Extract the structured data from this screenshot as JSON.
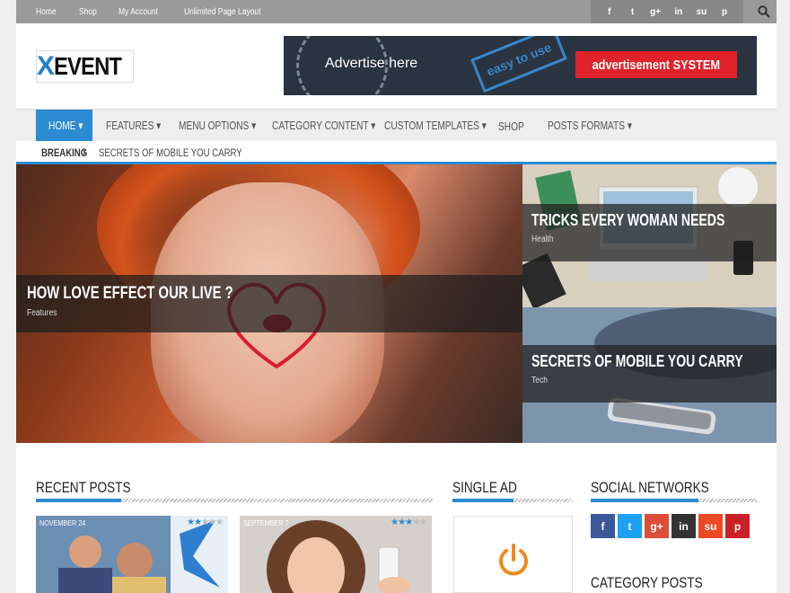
{
  "topbar": {
    "links": [
      "Home",
      "Shop",
      "My Account",
      "Unlimited Page Layout"
    ],
    "social_icons": [
      "f",
      "t",
      "g+",
      "in",
      "su",
      "p"
    ]
  },
  "header": {
    "logo_x": "X",
    "logo_rest": "EVENT",
    "ad": {
      "text": "Advertise here",
      "stamp": "easy to use",
      "button": "advertisement SYSTEM"
    }
  },
  "nav": {
    "items": [
      {
        "label": "HOME ▾"
      },
      {
        "label": "FEATURES ▾"
      },
      {
        "label": "MENU OPTIONS ▾"
      },
      {
        "label": "CATEGORY CONTENT ▾"
      },
      {
        "label": "CUSTOM TEMPLATES ▾"
      },
      {
        "label": "SHOP"
      },
      {
        "label": "POSTS FORMATS ▾"
      }
    ]
  },
  "breaking": {
    "label": "BREAKING",
    "ticker": "SECRETS OF MOBILE YOU CARRY"
  },
  "slider": {
    "main": {
      "title": "HOW LOVE EFFECT OUR LIVE ?",
      "category": "Features"
    },
    "side": [
      {
        "title": "TRICKS EVERY WOMAN NEEDS",
        "category": "Health"
      },
      {
        "title": "SECRETS OF MOBILE YOU CARRY",
        "category": "Tech"
      }
    ]
  },
  "widgets": {
    "recent_posts": "RECENT POSTS",
    "single_ad": "SINGLE AD",
    "social_networks": "SOCIAL NETWORKS",
    "category_posts": "CATEGORY POSTS"
  },
  "recent_posts": [
    {
      "date": "NOVEMBER 24",
      "rating": 2
    },
    {
      "date": "SEPTEMBER 7",
      "rating": 3
    }
  ],
  "social_buttons": [
    {
      "name": "facebook",
      "glyph": "f",
      "color": "#3b5998"
    },
    {
      "name": "twitter",
      "glyph": "t",
      "color": "#1da1f2"
    },
    {
      "name": "google-plus",
      "glyph": "g+",
      "color": "#dd4b39"
    },
    {
      "name": "linkedin",
      "glyph": "in",
      "color": "#333333"
    },
    {
      "name": "stumbleupon",
      "glyph": "su",
      "color": "#eb4924"
    },
    {
      "name": "pinterest",
      "glyph": "p",
      "color": "#cb2027"
    }
  ],
  "colors": {
    "accent": "#2b8ad1",
    "power_icon": "#f08a1c"
  }
}
